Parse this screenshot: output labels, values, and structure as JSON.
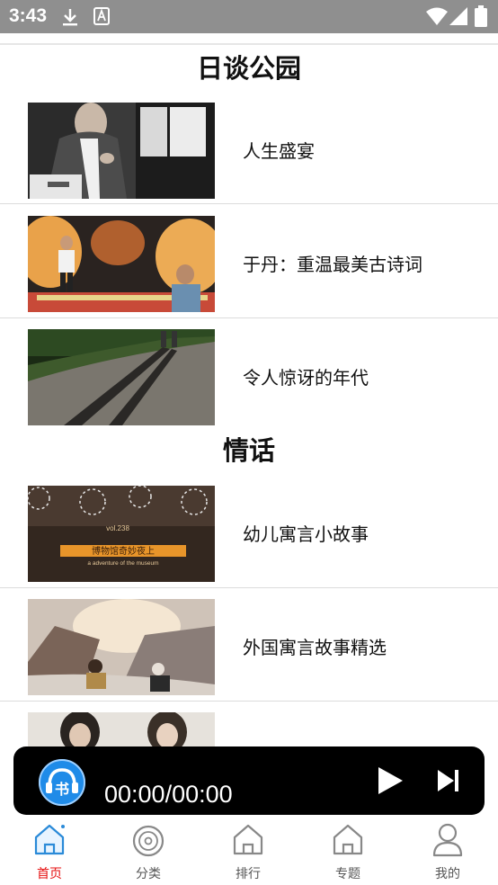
{
  "status_bar": {
    "time": "3:43"
  },
  "sections": [
    {
      "title": "日谈公园",
      "items": [
        {
          "title": "人生盛宴"
        },
        {
          "title": "于丹：重温最美古诗词"
        },
        {
          "title": "令人惊讶的年代"
        }
      ]
    },
    {
      "title": "情话",
      "items": [
        {
          "title": "幼儿寓言小故事"
        },
        {
          "title": "外国寓言故事精选"
        },
        {
          "title": ""
        }
      ]
    }
  ],
  "thumb_texts": {
    "museum_small": "vol.238",
    "museum_banner": "博物馆奇妙夜上",
    "museum_sub": "a adventure of the museum"
  },
  "player": {
    "logo_text": "书",
    "time": "00:00/00:00"
  },
  "tabs": [
    {
      "label": "首页",
      "icon": "home-icon",
      "active": true
    },
    {
      "label": "分类",
      "icon": "disc-icon",
      "active": false
    },
    {
      "label": "排行",
      "icon": "home-icon",
      "active": false
    },
    {
      "label": "专题",
      "icon": "home-icon",
      "active": false
    },
    {
      "label": "我的",
      "icon": "user-icon",
      "active": false
    }
  ],
  "colors": {
    "accent": "#1f8be8",
    "active_tab": "#e60f0f",
    "status_bar": "#8f8f8f",
    "player_bg": "#000000"
  }
}
